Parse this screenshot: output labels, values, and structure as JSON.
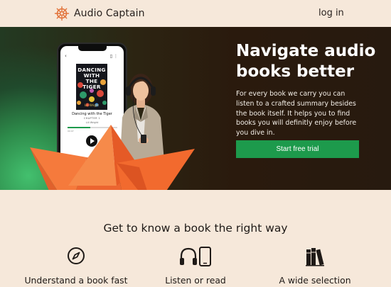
{
  "header": {
    "brand": "Audio Captain",
    "login_label": "log in",
    "logo_icon": "ship-wheel-icon"
  },
  "hero": {
    "title": "Navigate audio books better",
    "description": "For every book we carry you can listen to a crafted summary besides the book itself. It helps you to find books you will definitly enjoy before you dive in.",
    "cta_label": "Start free trial",
    "phone": {
      "cover_title": "DANCING WITH THE TIGER",
      "cover_author": "Lili Wright",
      "book_name": "Dancing with the Tiger",
      "chapter": "CHAPTER 1",
      "author": "Lili Wright",
      "time": "00:07",
      "progress": 0.45
    }
  },
  "features": {
    "title": "Get to know a book the right way",
    "items": [
      {
        "label": "Understand a book fast",
        "icon": "compass-icon"
      },
      {
        "label": "Listen or read",
        "icon": "headphones-phone-icon"
      },
      {
        "label": "A wide selection",
        "icon": "books-icon"
      }
    ]
  },
  "colors": {
    "background": "#f6e8da",
    "accent_green": "#1d9a4c",
    "hero_dark": "#2a1a0d",
    "boat_orange": "#f26a2e"
  }
}
